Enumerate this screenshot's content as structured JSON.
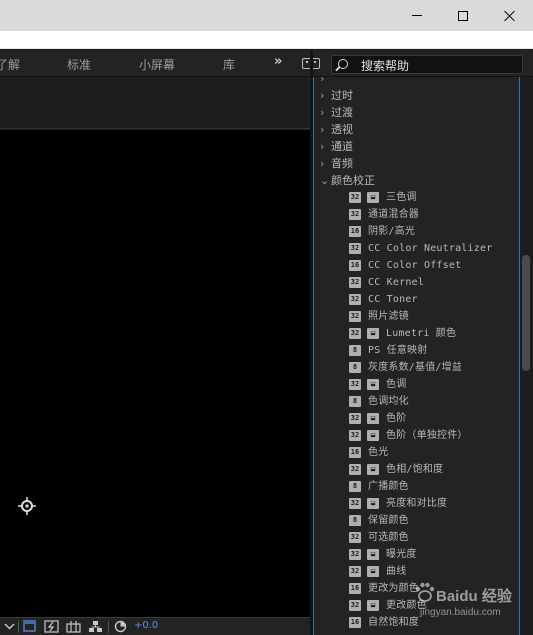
{
  "workspace": {
    "tabs": [
      "了解",
      "标准",
      "小屏幕",
      "库"
    ],
    "more_glyph": "»"
  },
  "search": {
    "text": "搜索帮助"
  },
  "effects_panel": {
    "categories": [
      {
        "label": "",
        "expanded": false,
        "partial": true
      },
      {
        "label": "过时",
        "expanded": false
      },
      {
        "label": "过渡",
        "expanded": false
      },
      {
        "label": "透视",
        "expanded": false
      },
      {
        "label": "通道",
        "expanded": false
      },
      {
        "label": "音频",
        "expanded": false
      },
      {
        "label": "颜色校正",
        "expanded": true
      }
    ],
    "items": [
      {
        "label": "三色调",
        "badges": [
          "32",
          "fx"
        ]
      },
      {
        "label": "通道混合器",
        "badges": [
          "32"
        ]
      },
      {
        "label": "阴影/高光",
        "badges": [
          "16"
        ]
      },
      {
        "label": "CC Color Neutralizer",
        "badges": [
          "32"
        ]
      },
      {
        "label": "CC Color Offset",
        "badges": [
          "16"
        ]
      },
      {
        "label": "CC Kernel",
        "badges": [
          "32"
        ]
      },
      {
        "label": "CC Toner",
        "badges": [
          "32"
        ]
      },
      {
        "label": "照片滤镜",
        "badges": [
          "32"
        ]
      },
      {
        "label": "Lumetri 颜色",
        "badges": [
          "32",
          "fx"
        ]
      },
      {
        "label": "PS 任意映射",
        "badges": [
          "8"
        ]
      },
      {
        "label": "灰度系数/基值/增益",
        "badges": [
          "8"
        ]
      },
      {
        "label": "色调",
        "badges": [
          "32",
          "fx"
        ]
      },
      {
        "label": "色调均化",
        "badges": [
          "8"
        ]
      },
      {
        "label": "色阶",
        "badges": [
          "32",
          "fx"
        ]
      },
      {
        "label": "色阶（单独控件）",
        "badges": [
          "32",
          "fx"
        ]
      },
      {
        "label": "色光",
        "badges": [
          "16"
        ]
      },
      {
        "label": "色相/饱和度",
        "badges": [
          "32",
          "fx"
        ]
      },
      {
        "label": "广播颜色",
        "badges": [
          "8"
        ]
      },
      {
        "label": "亮度和对比度",
        "badges": [
          "32",
          "fx"
        ]
      },
      {
        "label": "保留颜色",
        "badges": [
          "8"
        ]
      },
      {
        "label": "可选颜色",
        "badges": [
          "32"
        ]
      },
      {
        "label": "曝光度",
        "badges": [
          "32",
          "fx"
        ]
      },
      {
        "label": "曲线",
        "badges": [
          "32",
          "fx"
        ]
      },
      {
        "label": "更改为颜色",
        "badges": [
          "16"
        ]
      },
      {
        "label": "更改颜色",
        "badges": [
          "32",
          "fx"
        ]
      },
      {
        "label": "自然饱和度",
        "badges": [
          "16"
        ]
      }
    ]
  },
  "bottom_bar": {
    "exposure_value": "+0.0"
  },
  "watermark": {
    "main": "Baidu 经验",
    "sub": "jingyan.baidu.com"
  }
}
